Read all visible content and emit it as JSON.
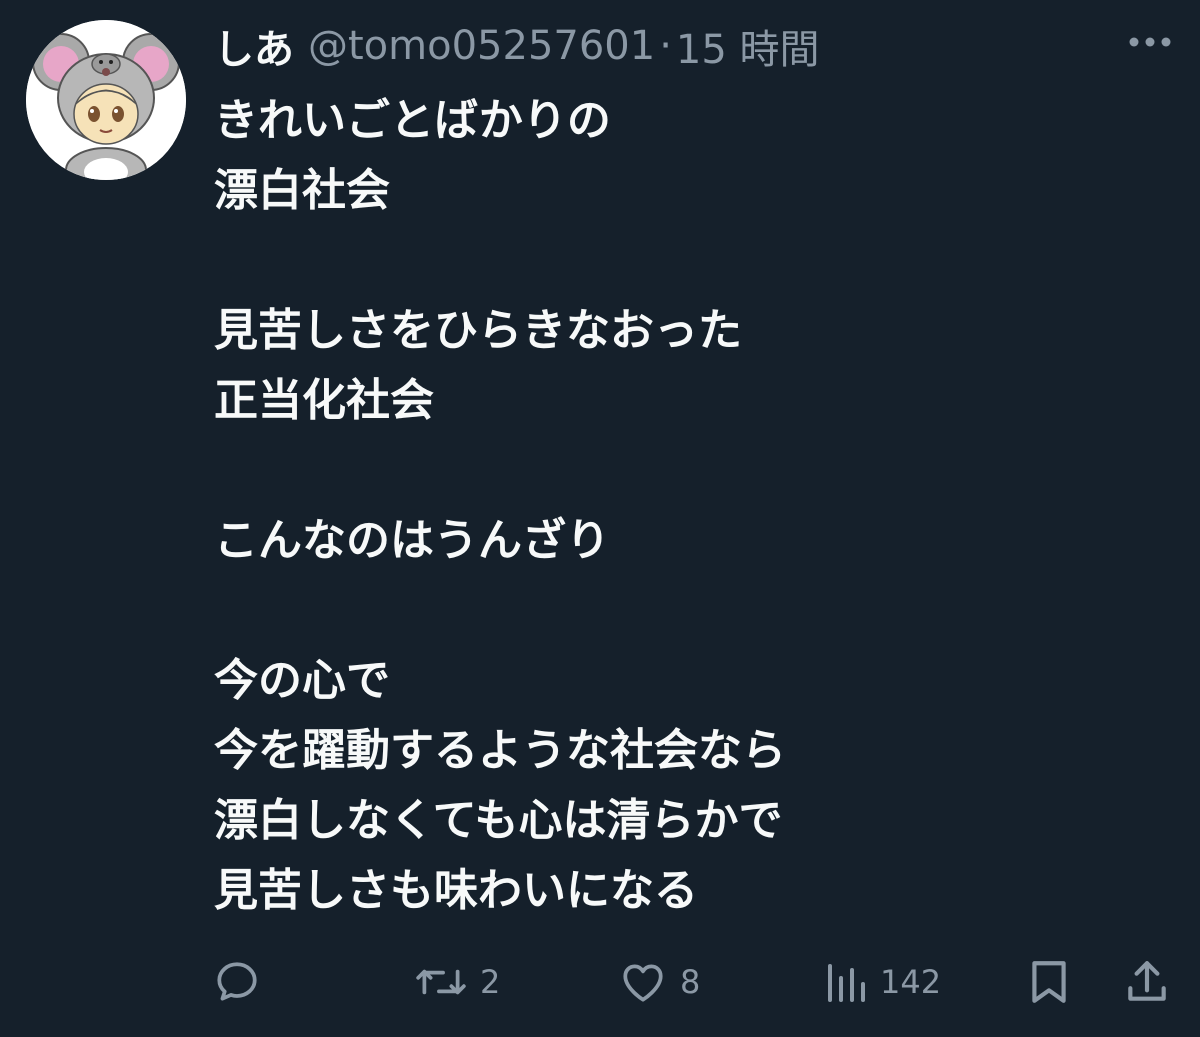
{
  "tweet": {
    "display_name": "しあ",
    "handle": "@tomo05257601",
    "separator": "·",
    "time": "15 時間",
    "more_icon": "more-horizontal-icon",
    "lines": [
      "きれいごとばかりの",
      "漂白社会",
      "",
      "見苦しさをひらきなおった",
      "正当化社会",
      "",
      "こんなのはうんざり",
      "",
      "今の心で",
      "今を躍動するような社会なら",
      "漂白しなくても心は清らかで",
      "見苦しさも味わいになる"
    ]
  },
  "actions": {
    "reply": {
      "icon": "reply-icon",
      "count": ""
    },
    "retweet": {
      "icon": "retweet-icon",
      "count": "2"
    },
    "like": {
      "icon": "heart-icon",
      "count": "8"
    },
    "views": {
      "icon": "views-icon",
      "count": "142"
    },
    "bookmark": {
      "icon": "bookmark-icon"
    },
    "share": {
      "icon": "share-icon"
    }
  },
  "colors": {
    "background": "#15202b",
    "text_primary": "#f7f9f9",
    "text_secondary": "#8b98a5"
  }
}
